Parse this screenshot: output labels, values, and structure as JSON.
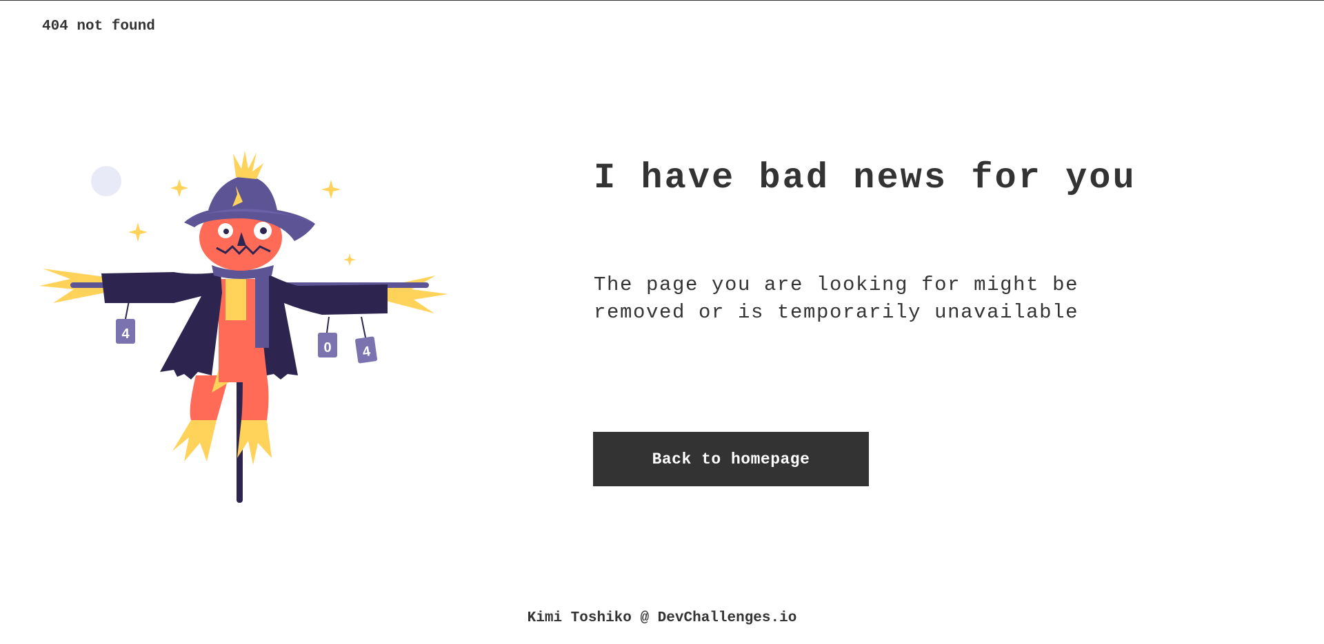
{
  "header": {
    "brand": "404 not found"
  },
  "main": {
    "headline": "I have bad news for you",
    "message": "The page you are looking for might be removed or is temporarily unavailable",
    "button_label": "Back to homepage"
  },
  "illustration": {
    "name": "scarecrow-illustration",
    "can_digits": [
      "4",
      "0",
      "4"
    ]
  },
  "footer": {
    "credit": "Kimi Toshiko @ DevChallenges.io"
  },
  "colors": {
    "text": "#333333",
    "button_bg": "#333333",
    "button_text": "#ffffff",
    "coat": "#2d2550",
    "hat": "#5d5496",
    "face": "#ff6b57",
    "straw": "#ffd25a",
    "moon": "#e8ebf7"
  }
}
